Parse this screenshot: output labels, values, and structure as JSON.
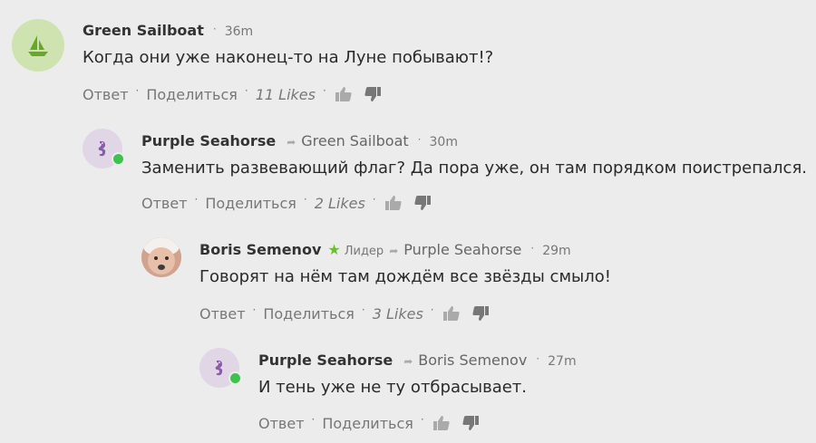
{
  "comments": [
    {
      "author": "Green Sailboat",
      "time": "36m",
      "text": "Когда они уже наконец-то на Луне побывают!?",
      "reply_label": "Ответ",
      "share_label": "Поделиться",
      "likes": "11 Likes",
      "avatar_color": "#cfe3b0",
      "avatar_icon": "sailboat-icon"
    },
    {
      "author": "Purple Seahorse",
      "reply_to": "Green Sailboat",
      "time": "30m",
      "text": "Заменить развевающий флаг? Да пора уже, он там порядком поистрепался.",
      "reply_label": "Ответ",
      "share_label": "Поделиться",
      "likes": "2 Likes",
      "avatar_color": "#e0d6e6",
      "avatar_icon": "seahorse-icon",
      "online": true
    },
    {
      "author": "Boris Semenov",
      "badge": "Лидер",
      "reply_to": "Purple Seahorse",
      "time": "29m",
      "text": "Говорят на нём там дождём все звёзды смыло!",
      "reply_label": "Ответ",
      "share_label": "Поделиться",
      "likes": "3 Likes",
      "avatar_icon": "baby-photo-avatar"
    },
    {
      "author": "Purple Seahorse",
      "reply_to": "Boris Semenov",
      "time": "27m",
      "text": "И тень уже не ту отбрасывает.",
      "reply_label": "Ответ",
      "share_label": "Поделиться",
      "avatar_color": "#e0d6e6",
      "avatar_icon": "seahorse-icon",
      "online": true
    }
  ],
  "colors": {
    "background": "#ececec",
    "online_dot": "#3cc24e",
    "leader_star": "#6bbf2f",
    "seahorse": "#8a5ba8",
    "sailboat": "#6aa62b"
  }
}
